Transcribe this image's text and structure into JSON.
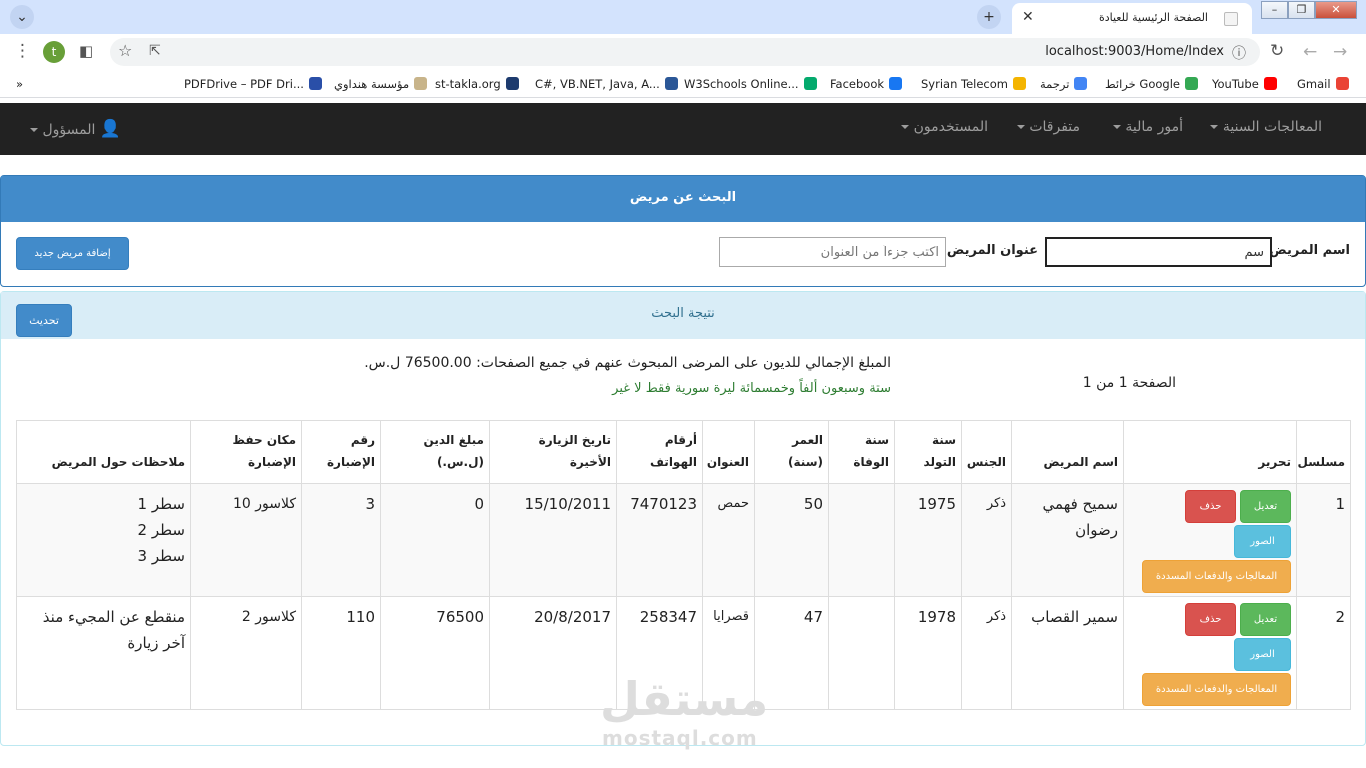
{
  "browser": {
    "tab_title": "الصفحة الرئيسية للعيادة",
    "new_tab": "+",
    "close_tab": "✕",
    "url": "localhost:9003/Home/Index",
    "profile_initial": "t",
    "bookmarks": [
      {
        "label": "Gmail",
        "icon": "gmail-icon",
        "color": "#ea4335"
      },
      {
        "label": "YouTube",
        "icon": "youtube-icon",
        "color": "#ff0000"
      },
      {
        "label": "خرائط Google",
        "icon": "maps-icon",
        "color": "#34a853"
      },
      {
        "label": "ترجمة",
        "icon": "translate-icon",
        "color": "#4285f4"
      },
      {
        "label": "Syrian Telecom",
        "icon": "telecom-icon",
        "color": "#f4b400"
      },
      {
        "label": "Facebook",
        "icon": "facebook-icon",
        "color": "#1877f2"
      },
      {
        "label": "W3Schools Online...",
        "icon": "w3schools-icon",
        "color": "#04aa6d"
      },
      {
        "label": "C#, VB.NET, Java, A...",
        "icon": "code-icon",
        "color": "#2b5797"
      },
      {
        "label": "st-takla.org",
        "icon": "stakla-icon",
        "color": "#1d3b6e"
      },
      {
        "label": "مؤسسة هنداوي",
        "icon": "hindawi-icon",
        "color": "#c8b48a"
      },
      {
        "label": "PDFDrive – PDF Dri...",
        "icon": "pdfdrive-icon",
        "color": "#2a4fa8"
      },
      {
        "label": "»",
        "icon": "more-bookmarks-icon",
        "color": "#555555"
      }
    ]
  },
  "navbar": {
    "items": [
      "المعالجات السنية",
      "أمور مالية",
      "متفرقات",
      "المستخدمون"
    ],
    "user": "المسؤول"
  },
  "search": {
    "title": "البحث عن مريض",
    "name_label": "اسم المريض",
    "name_value": "سم",
    "address_label": "عنوان المريض",
    "address_placeholder": "اكتب جزءاً من العنوان",
    "add_button": "إضافة مريض جديد"
  },
  "results": {
    "title": "نتيجة البحث",
    "refresh_button": "تحديث",
    "total_text": "المبلغ الإجمالي للديون على المرضى المبحوث عنهم في جميع الصفحات: 76500.00 ل.س.",
    "total_words": "ستة وسبعون ألفاً وخمسمائة ليرة سورية فقط لا غير",
    "paging": "الصفحة 1 من 1",
    "columns": [
      "مسلسل",
      "تحرير",
      "اسم المريض",
      "الجنس",
      "سنة التولد",
      "سنة الوفاة",
      "العمر (سنة)",
      "العنوان",
      "أرقام الهواتف",
      "تاريخ الزيارة الأخيرة",
      "مبلغ الدين (ل.س.)",
      "رقم الإضبارة",
      "مكان حفظ الإضبارة",
      "ملاحظات حول المريض"
    ],
    "row_buttons": {
      "edit": "تعديل",
      "delete": "حذف",
      "photos": "الصور",
      "treatments": "المعالجات والدفعات المسددة"
    },
    "rows": [
      {
        "serial": "1",
        "name": "سميح فهمي رضوان",
        "gender": "ذكر",
        "birth_year": "1975",
        "death_year": "",
        "age": "50",
        "address": "حمص",
        "phones": "7470123",
        "last_visit": "15/10/2011",
        "debt": "0",
        "file_no": "3",
        "file_place": "كلاسور 10",
        "notes": [
          "سطر 1",
          "سطر 2",
          "سطر 3"
        ]
      },
      {
        "serial": "2",
        "name": "سمير القصاب",
        "gender": "ذكر",
        "birth_year": "1978",
        "death_year": "",
        "age": "47",
        "address": "قصرايا",
        "phones": "258347",
        "last_visit": "20/8/2017",
        "debt": "76500",
        "file_no": "110",
        "file_place": "كلاسور 2",
        "notes": [
          "منقطع عن المجيء منذ آخر زيارة"
        ]
      }
    ]
  },
  "watermark": {
    "arabic": "مستقل",
    "latin": "mostaql.com"
  }
}
